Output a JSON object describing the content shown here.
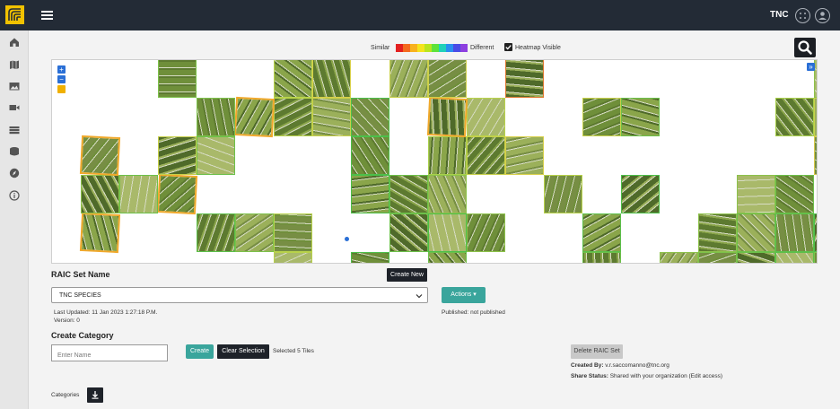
{
  "app": {
    "brand": "TNC",
    "icons": {
      "logo": "tnc-logo",
      "menu": "hamburger-icon",
      "apps": "apps-grid-icon",
      "user": "user-icon"
    }
  },
  "sidebar": {
    "items": [
      {
        "icon": "home-icon"
      },
      {
        "icon": "map-icon"
      },
      {
        "icon": "image-icon"
      },
      {
        "icon": "video-icon"
      },
      {
        "icon": "layers-icon"
      },
      {
        "icon": "database-icon"
      },
      {
        "icon": "compass-icon"
      },
      {
        "icon": "info-icon"
      }
    ]
  },
  "heatmap": {
    "similar_label": "Similar",
    "different_label": "Different",
    "colors": [
      "#e32020",
      "#f46a1e",
      "#f8b21d",
      "#f4e41d",
      "#b9e51e",
      "#5ee33a",
      "#20d1b9",
      "#2a8ef0",
      "#4a4be6",
      "#8d3fe0"
    ],
    "visible_label": "Heatmap Visible",
    "visible_checked": true
  },
  "viewer": {
    "zoom_in": "+",
    "zoom_out": "−",
    "selected_count": 5,
    "grid_columns": 20,
    "tiles": [
      {
        "col": 2,
        "row": 0,
        "border": "#7cc14a"
      },
      {
        "col": 5,
        "row": 0,
        "border": "#b9d54a"
      },
      {
        "col": 6,
        "row": 0,
        "border": "#d9d04a"
      },
      {
        "col": 8,
        "row": 0,
        "border": "#c9d04a"
      },
      {
        "col": 9,
        "row": 0,
        "border": "#d0d04a"
      },
      {
        "col": 11,
        "row": 0,
        "border": "#e07830"
      },
      {
        "col": 19,
        "row": 0,
        "border": "#8cc24a"
      },
      {
        "col": 3,
        "row": 1,
        "border": "#7cc14a"
      },
      {
        "col": 4,
        "row": 1,
        "border": "#f0a82a",
        "selected": true
      },
      {
        "col": 5,
        "row": 1,
        "border": "#b8d24a"
      },
      {
        "col": 6,
        "row": 1,
        "border": "#c8d04a"
      },
      {
        "col": 7,
        "row": 1,
        "border": "#4cbf4a"
      },
      {
        "col": 9,
        "row": 1,
        "border": "#f0a82a",
        "selected": true
      },
      {
        "col": 10,
        "row": 1,
        "border": "#b8d24a"
      },
      {
        "col": 13,
        "row": 1,
        "border": "#c8d04a"
      },
      {
        "col": 14,
        "row": 1,
        "border": "#6cc04a"
      },
      {
        "col": 18,
        "row": 1,
        "border": "#a8d04a"
      },
      {
        "col": 19,
        "row": 1,
        "border": "#c8d24a"
      },
      {
        "col": 0,
        "row": 2,
        "border": "#f0a82a",
        "selected": true
      },
      {
        "col": 2,
        "row": 2,
        "border": "#c8d04a"
      },
      {
        "col": 3,
        "row": 2,
        "border": "#6cc04a"
      },
      {
        "col": 7,
        "row": 2,
        "border": "#4cbf4a"
      },
      {
        "col": 9,
        "row": 2,
        "border": "#a8d04a"
      },
      {
        "col": 10,
        "row": 2,
        "border": "#c8d04a"
      },
      {
        "col": 11,
        "row": 2,
        "border": "#d8d04a"
      },
      {
        "col": 19,
        "row": 2,
        "border": "#d8c84a"
      },
      {
        "col": 0,
        "row": 3,
        "border": "#8cc24a"
      },
      {
        "col": 1,
        "row": 3,
        "border": "#6cc04a"
      },
      {
        "col": 2,
        "row": 3,
        "border": "#f0a82a",
        "selected": true
      },
      {
        "col": 7,
        "row": 3,
        "border": "#4cbf4a"
      },
      {
        "col": 8,
        "row": 3,
        "border": "#6cc04a"
      },
      {
        "col": 9,
        "row": 3,
        "border": "#8cc24a"
      },
      {
        "col": 12,
        "row": 3,
        "border": "#b8d24a"
      },
      {
        "col": 14,
        "row": 3,
        "border": "#4cbf4a"
      },
      {
        "col": 17,
        "row": 3,
        "border": "#8cc24a"
      },
      {
        "col": 18,
        "row": 3,
        "border": "#6cc04a"
      },
      {
        "col": 0,
        "row": 4,
        "border": "#f0a82a",
        "selected": true
      },
      {
        "col": 3,
        "row": 4,
        "border": "#5cbf4a"
      },
      {
        "col": 4,
        "row": 4,
        "border": "#7cc14a"
      },
      {
        "col": 5,
        "row": 4,
        "border": "#b8d24a"
      },
      {
        "col": 8,
        "row": 4,
        "border": "#6cc04a"
      },
      {
        "col": 9,
        "row": 4,
        "border": "#4cbf4a"
      },
      {
        "col": 10,
        "row": 4,
        "border": "#8cc24a"
      },
      {
        "col": 13,
        "row": 4,
        "border": "#5cbf4a"
      },
      {
        "col": 16,
        "row": 4,
        "border": "#8cc24a"
      },
      {
        "col": 17,
        "row": 4,
        "border": "#6cc04a"
      },
      {
        "col": 18,
        "row": 4,
        "border": "#5cbf4a"
      },
      {
        "col": 19,
        "row": 4,
        "border": "#4cbf4a"
      },
      {
        "col": 5,
        "row": 5,
        "border": "#b8d24a"
      },
      {
        "col": 7,
        "row": 5,
        "border": "#4cbf4a"
      },
      {
        "col": 9,
        "row": 5,
        "border": "#6cc04a"
      },
      {
        "col": 13,
        "row": 5,
        "border": "#6cc04a"
      },
      {
        "col": 15,
        "row": 5,
        "border": "#8cc24a"
      },
      {
        "col": 16,
        "row": 5,
        "border": "#7cc14a"
      },
      {
        "col": 17,
        "row": 5,
        "border": "#6cc04a"
      },
      {
        "col": 18,
        "row": 5,
        "border": "#5cbf4a"
      },
      {
        "col": 19,
        "row": 5,
        "border": "#7cc14a"
      }
    ]
  },
  "raic": {
    "title": "RAIC Set Name",
    "create_new": "Create New",
    "selected_set": "TNC SPECIES",
    "last_updated": "Last Updated: 11 Jan 2023 1:27:18 P.M.",
    "version": "Version: 0",
    "actions": "Actions",
    "published": "Published: not published",
    "delete": "Delete RAIC Set",
    "created_by_label": "Created By:",
    "created_by": "v.r.saccomanno@tnc.org",
    "share_label": "Share Status:",
    "share_status": "Shared with your organization (Edit access)"
  },
  "category": {
    "title": "Create Category",
    "placeholder": "Enter Name",
    "create": "Create",
    "clear": "Clear Selection",
    "selected": "Selected 5 Tiles",
    "list_label": "Categories",
    "download_icon": "download-icon"
  }
}
